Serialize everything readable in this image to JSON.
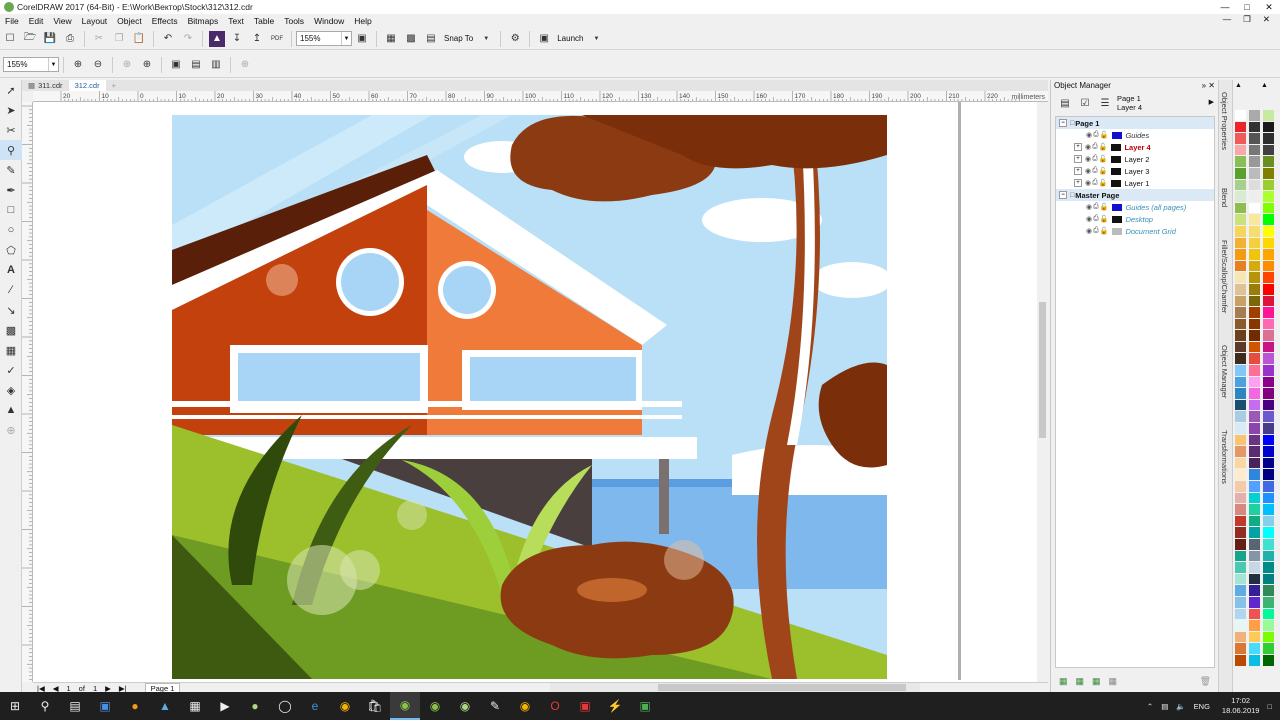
{
  "window": {
    "title": "CorelDRAW 2017 (64-Bit) - E:\\Work\\Вектор\\Stock\\312\\312.cdr"
  },
  "menu": [
    "File",
    "Edit",
    "View",
    "Layout",
    "Object",
    "Effects",
    "Bitmaps",
    "Text",
    "Table",
    "Tools",
    "Window",
    "Help"
  ],
  "toolbar": {
    "zoom_value": "155%",
    "snap_label": "Snap To",
    "launch_label": "Launch"
  },
  "propbar": {
    "zoom_value": "155%"
  },
  "doc_tabs": [
    {
      "label": "311.cdr"
    },
    {
      "label": "312.cdr"
    }
  ],
  "ruler": {
    "units": "millimeters",
    "h_ticks": [
      "20",
      "10",
      "0",
      "10",
      "20",
      "30",
      "40",
      "50",
      "60",
      "70",
      "80",
      "90",
      "100",
      "110",
      "120",
      "130",
      "140",
      "150",
      "160",
      "170",
      "180",
      "190",
      "200",
      "210",
      "220"
    ]
  },
  "status": {
    "page_current": "1",
    "page_of": "of",
    "page_total": "1",
    "page_tab": "Page 1"
  },
  "object_manager": {
    "title": "Object Manager",
    "current_page": "Page 1",
    "current_layer": "Layer 4",
    "page1": {
      "label": "Page 1",
      "layers": [
        {
          "label": "Guides",
          "color": "#1010d0",
          "style": "guides"
        },
        {
          "label": "Layer 4",
          "color": "#111111",
          "style": "active"
        },
        {
          "label": "Layer 2",
          "color": "#111111",
          "style": "normal"
        },
        {
          "label": "Layer 3",
          "color": "#111111",
          "style": "normal"
        },
        {
          "label": "Layer 1",
          "color": "#111111",
          "style": "normal"
        }
      ]
    },
    "master": {
      "label": "Master Page",
      "layers": [
        {
          "label": "Guides (all pages)",
          "color": "#1010d0"
        },
        {
          "label": "Desktop",
          "color": "#111111"
        },
        {
          "label": "Document Grid",
          "color": "#bbbbbb"
        }
      ]
    }
  },
  "docker_tabs": [
    "Object Properties",
    "Blend",
    "Fillet/Scallop/Chamfer",
    "Object Manager",
    "Transformations"
  ],
  "palette": {
    "col1": [
      "#ffffff",
      "#e8262b",
      "#f15a5a",
      "#f7a8a8",
      "#88c057",
      "#5aa02c",
      "#a8d08d",
      "#d9ead3",
      "#8fbc4f",
      "#c9e27c",
      "#f6d55c",
      "#f2b134",
      "#f39c12",
      "#e67e22",
      "#f6e6b4",
      "#e0c097",
      "#c8a165",
      "#a67c52",
      "#8b5a2b",
      "#6b3e1e",
      "#5b3a29",
      "#3d2b1f",
      "#7fc8f8",
      "#4aa3df",
      "#2e86c1",
      "#1b4f72",
      "#a9cce3",
      "#d6eaf8",
      "#f8c471",
      "#e59866",
      "#fad7a0",
      "#fdebd0",
      "#f5cba7",
      "#e6b0aa",
      "#d98880",
      "#c0392b",
      "#922b21",
      "#641e16",
      "#17a589",
      "#48c9b0",
      "#a3e4d7",
      "#5dade2",
      "#85c1e9",
      "#aed6f1",
      "#e8f6f3",
      "#f0b27a",
      "#dc7633",
      "#ba4a00"
    ],
    "col2": [
      "#aaaaaa",
      "#333333",
      "#555555",
      "#777777",
      "#999999",
      "#bbbbbb",
      "#dddddd",
      "#eeeeee",
      "#ffffff",
      "#f9e79f",
      "#f7dc6f",
      "#f4d03f",
      "#f1c40f",
      "#d4ac0d",
      "#b7950b",
      "#9a7d0a",
      "#7d6608",
      "#a04000",
      "#873600",
      "#6e2c00",
      "#d35400",
      "#e74c3c",
      "#ff6f91",
      "#ff9ff3",
      "#f368e0",
      "#c56cf0",
      "#9b59b6",
      "#8e44ad",
      "#6c3483",
      "#5b2c6f",
      "#4a235a",
      "#2e86de",
      "#54a0ff",
      "#00d2d3",
      "#1dd1a1",
      "#10ac84",
      "#01a3a4",
      "#576574",
      "#8395a7",
      "#c8d6e5",
      "#222f3e",
      "#341f97",
      "#5f27cd",
      "#ee5253",
      "#ff9f43",
      "#feca57",
      "#48dbfb",
      "#0abde3"
    ],
    "col3": [
      "#c7e9a0",
      "#1a1a1a",
      "#2d2d2d",
      "#404040",
      "#6b8e23",
      "#808000",
      "#9acd32",
      "#adff2f",
      "#7fff00",
      "#00ff00",
      "#ffff00",
      "#ffd700",
      "#ffa500",
      "#ff8c00",
      "#ff4500",
      "#ff0000",
      "#dc143c",
      "#ff1493",
      "#ff69b4",
      "#db7093",
      "#c71585",
      "#ba55d3",
      "#9932cc",
      "#8b008b",
      "#800080",
      "#4b0082",
      "#6a5acd",
      "#483d8b",
      "#0000ff",
      "#0000cd",
      "#00008b",
      "#000080",
      "#4169e1",
      "#1e90ff",
      "#00bfff",
      "#87ceeb",
      "#00ffff",
      "#40e0d0",
      "#20b2aa",
      "#008b8b",
      "#008080",
      "#2e8b57",
      "#3cb371",
      "#00fa9a",
      "#98fb98",
      "#7cfc00",
      "#32cd32",
      "#006400"
    ]
  },
  "taskbar": {
    "lang": "ENG",
    "time": "17:02",
    "date": "18.06.2019"
  }
}
